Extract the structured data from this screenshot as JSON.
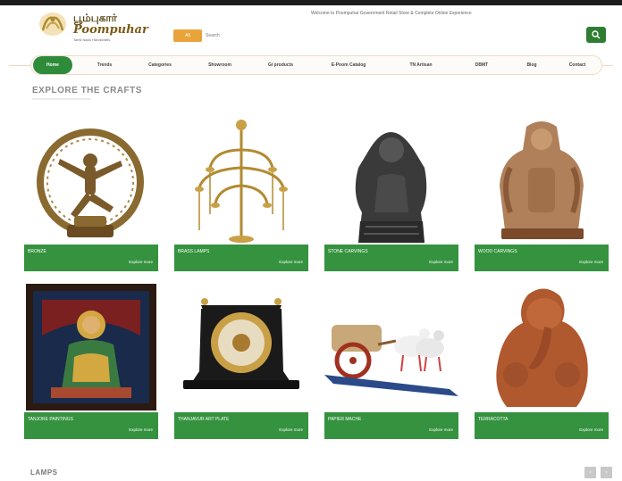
{
  "header": {
    "logo_tamil": "பூம்புகார்",
    "logo_brand": "Poompuhar",
    "logo_tagline": "Tamil Nadu Handicrafts",
    "welcome": "Welcome to Poompuhar Government Retail Store & Complete Online Experience",
    "search": {
      "category": "All",
      "placeholder": "Search"
    }
  },
  "nav": {
    "items": [
      {
        "label": "Home"
      },
      {
        "label": "Trends"
      },
      {
        "label": "Categories"
      },
      {
        "label": "Showroom"
      },
      {
        "label": "Gi products"
      },
      {
        "label": "E-Poom Catalog"
      },
      {
        "label": "TN Artisan"
      },
      {
        "label": "DBMT"
      },
      {
        "label": "Blog"
      },
      {
        "label": "Contact"
      }
    ]
  },
  "section": {
    "title": "EXPLORE THE CRAFTS",
    "subtitle": ""
  },
  "products": [
    {
      "name": "BRONZE",
      "link": "Explore more",
      "icon": "nataraja-statue"
    },
    {
      "name": "BRASS LAMPS",
      "link": "Explore more",
      "icon": "brass-lamp"
    },
    {
      "name": "STONE CARVINGS",
      "link": "Explore more",
      "icon": "stone-sculpture"
    },
    {
      "name": "WOOD CARVINGS",
      "link": "Explore more",
      "icon": "wood-carving"
    },
    {
      "name": "TANJORE PAINTINGS",
      "link": "Explore more",
      "icon": "tanjore-painting"
    },
    {
      "name": "THANJAVUR ART PLATE",
      "link": "Explore more",
      "icon": "art-plate"
    },
    {
      "name": "PAPIER MACHE",
      "link": "Explore more",
      "icon": "bullock-cart"
    },
    {
      "name": "TERRACOTTA",
      "link": "Explore more",
      "icon": "terracotta-ganesha"
    }
  ],
  "lamps_section": {
    "title": "LAMPS"
  },
  "colors": {
    "accent_green": "#35923f",
    "nav_green": "#2e8b3a",
    "chip_orange": "#e8a43a"
  }
}
